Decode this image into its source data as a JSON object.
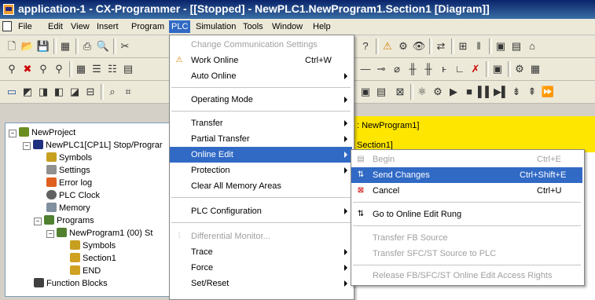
{
  "window": {
    "title": "application-1 - CX-Programmer - [[Stopped] - NewPLC1.NewProgram1.Section1 [Diagram]]"
  },
  "menubar": {
    "items": [
      "File",
      "Edit",
      "View",
      "Insert",
      "Program",
      "PLC",
      "Simulation",
      "Tools",
      "Window",
      "Help"
    ],
    "active": "PLC"
  },
  "tree": {
    "project": "NewProject",
    "plc": "NewPLC1[CP1L] Stop/Prograr",
    "items": [
      "Symbols",
      "Settings",
      "Error log",
      "PLC Clock",
      "Memory",
      "Programs"
    ],
    "program": "NewProgram1 (00) St",
    "program_items": [
      "Symbols",
      "Section1",
      "END"
    ],
    "function_blocks": "Function Blocks"
  },
  "diagram": {
    "program_label": ": NewProgram1]",
    "section_label": "Section1]"
  },
  "plc_menu": {
    "items": [
      {
        "label": "Change Communication Settings",
        "disabled": true
      },
      {
        "label": "Work Online",
        "shortcut": "Ctrl+W"
      },
      {
        "label": "Auto Online",
        "submenu": true
      },
      {
        "label": "Operating Mode",
        "submenu": true
      },
      {
        "label": "Transfer",
        "submenu": true
      },
      {
        "label": "Partial Transfer",
        "submenu": true
      },
      {
        "label": "Online Edit",
        "submenu": true,
        "highlighted": true
      },
      {
        "label": "Protection",
        "submenu": true
      },
      {
        "label": "Clear All Memory Areas"
      },
      {
        "label": "PLC Configuration",
        "submenu": true
      },
      {
        "label": "Differential Monitor...",
        "disabled": true
      },
      {
        "label": "Trace",
        "submenu": true
      },
      {
        "label": "Force",
        "submenu": true
      },
      {
        "label": "Set/Reset",
        "submenu": true
      }
    ]
  },
  "online_edit_menu": {
    "items": [
      {
        "label": "Begin",
        "shortcut": "Ctrl+E",
        "disabled": true
      },
      {
        "label": "Send Changes",
        "shortcut": "Ctrl+Shift+E",
        "highlighted": true
      },
      {
        "label": "Cancel",
        "shortcut": "Ctrl+U"
      },
      {
        "label": "Go to Online Edit Rung"
      },
      {
        "label": "Transfer FB Source",
        "disabled": true
      },
      {
        "label": "Transfer SFC/ST Source to PLC",
        "disabled": true
      },
      {
        "label": "Release FB/SFC/ST Online Edit Access Rights",
        "disabled": true
      }
    ]
  },
  "colors": {
    "highlight": "#316ac5",
    "yellow_band": "#ffe600",
    "title_bar": "#0a246a"
  }
}
